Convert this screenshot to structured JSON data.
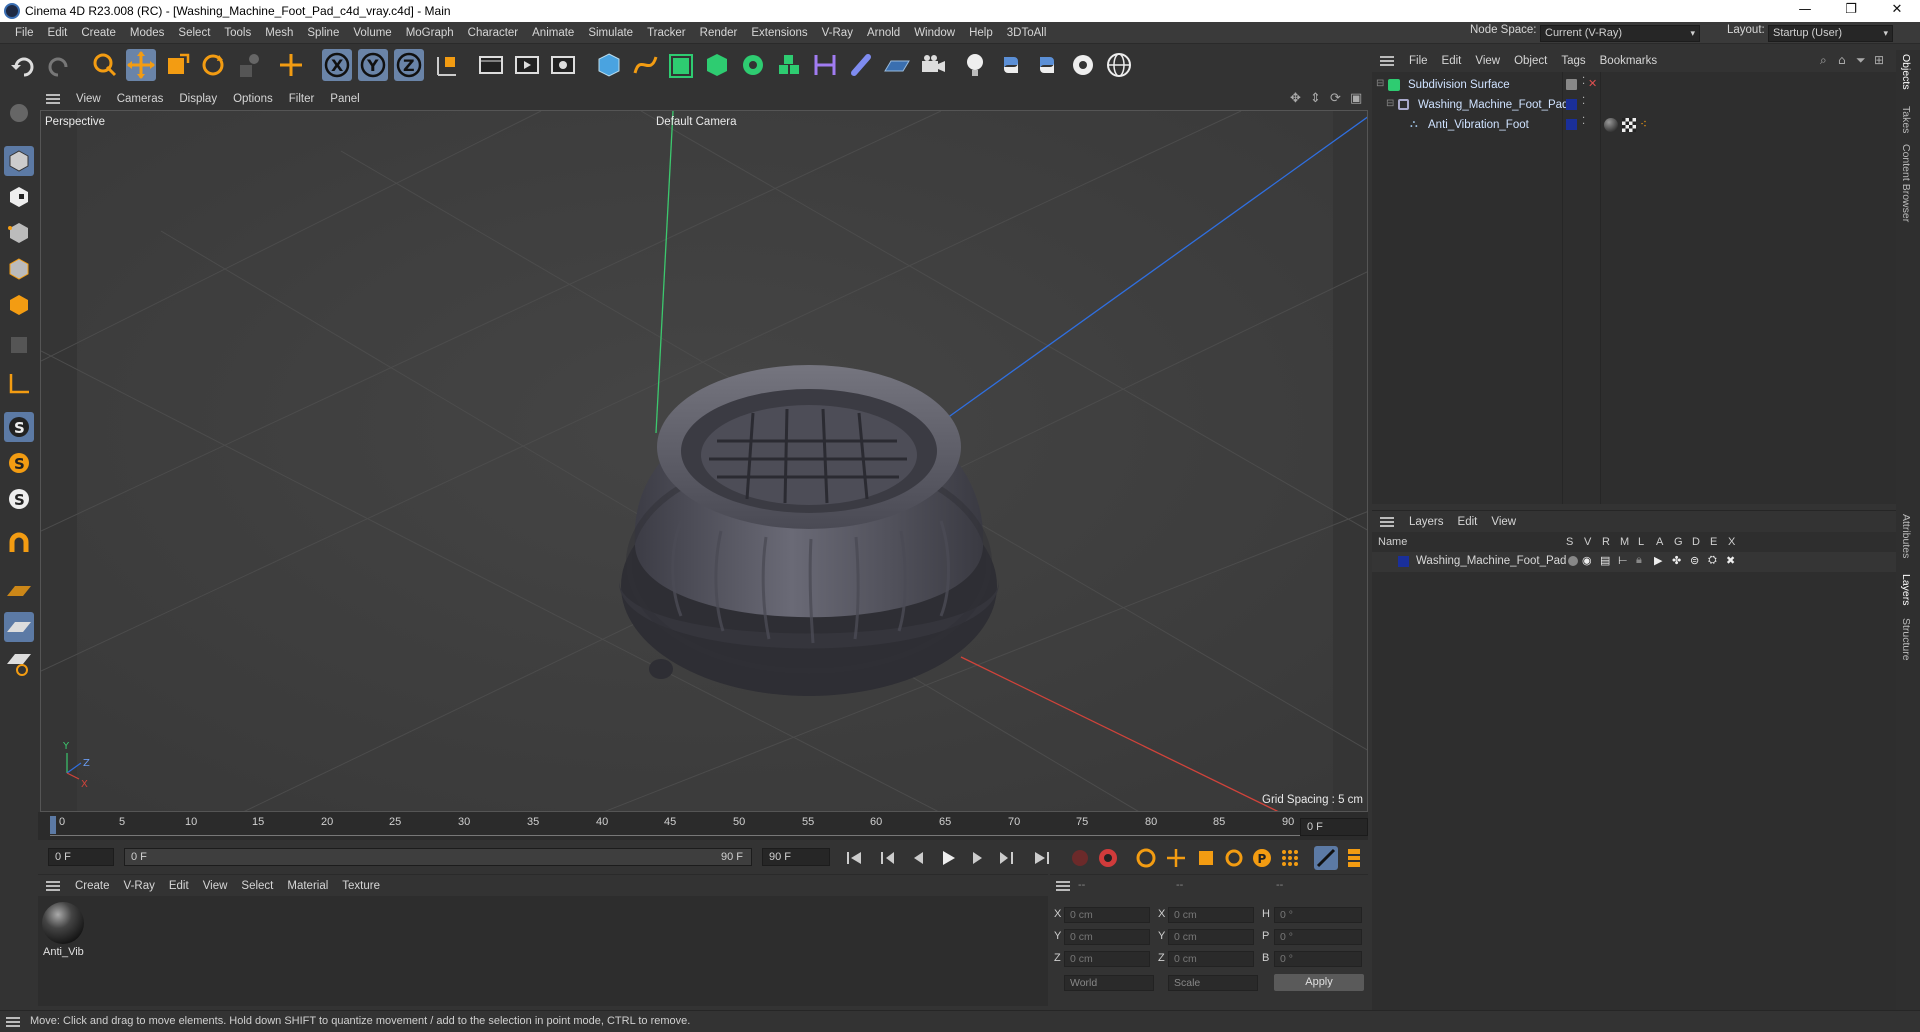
{
  "titlebar": {
    "title": "Cinema 4D R23.008 (RC) - [Washing_Machine_Foot_Pad_c4d_vray.c4d] - Main",
    "minimize": "—",
    "maximize": "❐",
    "close": "✕"
  },
  "menubar": {
    "items": [
      "File",
      "Edit",
      "Create",
      "Modes",
      "Select",
      "Tools",
      "Mesh",
      "Spline",
      "Volume",
      "MoGraph",
      "Character",
      "Animate",
      "Simulate",
      "Tracker",
      "Render",
      "Extensions",
      "V-Ray",
      "Arnold",
      "Window",
      "Help",
      "3DToAll"
    ],
    "node_space_label": "Node Space:",
    "node_space_value": "Current (V-Ray)",
    "layout_label": "Layout:",
    "layout_value": "Startup (User)"
  },
  "viewport": {
    "menu": [
      "View",
      "Cameras",
      "Display",
      "Options",
      "Filter",
      "Panel"
    ],
    "label": "Perspective",
    "camera": "Default Camera",
    "grid_spacing": "Grid Spacing : 5 cm",
    "axis_labels": {
      "y": "Y",
      "z": "Z",
      "x": "X"
    }
  },
  "timeline": {
    "ticks": [
      "0",
      "5",
      "10",
      "15",
      "20",
      "25",
      "30",
      "35",
      "40",
      "45",
      "50",
      "55",
      "60",
      "65",
      "70",
      "75",
      "80",
      "85",
      "90"
    ],
    "current_frame": "0 F"
  },
  "transport": {
    "start": "0 F",
    "range_start": "0 F",
    "range_end": "90 F",
    "end": "90 F"
  },
  "material_manager": {
    "menu": [
      "Create",
      "V-Ray",
      "Edit",
      "View",
      "Select",
      "Material",
      "Texture"
    ],
    "material_name": "Anti_Vib"
  },
  "coordinates": {
    "header": [
      "--",
      "--",
      "--"
    ],
    "rows": [
      {
        "l1": "X",
        "v1": "0 cm",
        "l2": "X",
        "v2": "0 cm",
        "l3": "H",
        "v3": "0 °"
      },
      {
        "l1": "Y",
        "v1": "0 cm",
        "l2": "Y",
        "v2": "0 cm",
        "l3": "P",
        "v3": "0 °"
      },
      {
        "l1": "Z",
        "v1": "0 cm",
        "l2": "Z",
        "v2": "0 cm",
        "l3": "B",
        "v3": "0 °"
      }
    ],
    "space": "World",
    "mode": "Scale",
    "apply": "Apply"
  },
  "objects_panel": {
    "menu": [
      "File",
      "Edit",
      "View",
      "Object",
      "Tags",
      "Bookmarks"
    ],
    "rows": [
      {
        "name": "Subdivision Surface"
      },
      {
        "name": "Washing_Machine_Foot_Pad"
      },
      {
        "name": "Anti_Vibration_Foot"
      }
    ]
  },
  "layers_panel": {
    "menu": [
      "Layers",
      "Edit",
      "View"
    ],
    "columns": {
      "name": "Name",
      "flags": [
        "S",
        "V",
        "R",
        "M",
        "L",
        "A",
        "G",
        "D",
        "E",
        "X"
      ]
    },
    "rows": [
      {
        "name": "Washing_Machine_Foot_Pad",
        "color": "#1a2f9a"
      }
    ]
  },
  "side_tabs": [
    "Objects",
    "Takes",
    "Content Browser",
    "Attributes",
    "Layers",
    "Structure"
  ],
  "status": "Move: Click and drag to move elements. Hold down SHIFT to quantize movement / add to the selection in point mode, CTRL to remove.",
  "colors": {
    "accent": "#f39c12",
    "selection_blue": "#5c7aa5",
    "layer_blue": "#1a2f9a"
  }
}
